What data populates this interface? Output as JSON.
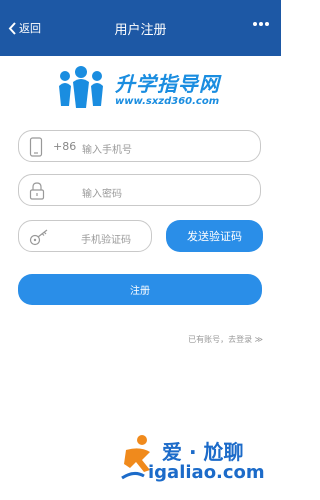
{
  "nav": {
    "back_label": "返回",
    "title": "用户注册",
    "more_icon": "more-dots-icon"
  },
  "logo": {
    "name": "升学指导网",
    "url": "www.sxzd360.com"
  },
  "form": {
    "phone_country_code": "+86",
    "phone_placeholder": "输入手机号",
    "password_placeholder": "输入密码",
    "sms_code_placeholder": "手机验证码",
    "send_code_label": "发送验证码",
    "register_label": "注册",
    "login_link": "已有账号，去登录 ≫"
  },
  "watermark": {
    "line1": "爱 · 尬聊",
    "line2": "igaliao.com"
  },
  "colors": {
    "nav_bg": "#1d58a5",
    "accent": "#2a8ee8",
    "field_border": "#c9c9c9"
  }
}
